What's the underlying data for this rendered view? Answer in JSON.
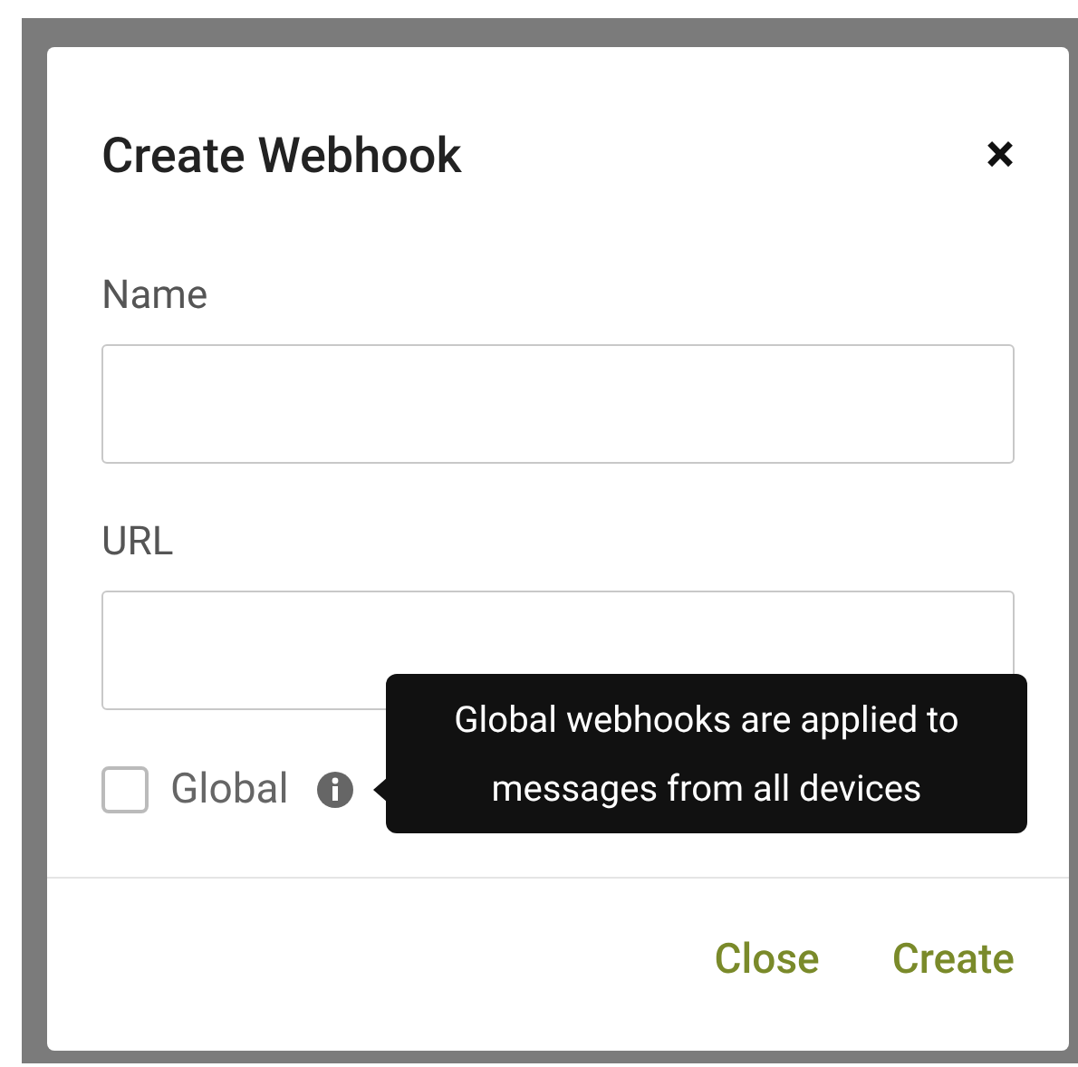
{
  "dialog": {
    "title": "Create Webhook",
    "close_icon": "×"
  },
  "fields": [
    {
      "label": "Name"
    },
    {
      "label": "URL"
    }
  ],
  "global": {
    "label": "Global",
    "checked": false,
    "tooltip": "Global webhooks are applied to messages from all devices"
  },
  "buttons": [
    "Close",
    "Create"
  ]
}
